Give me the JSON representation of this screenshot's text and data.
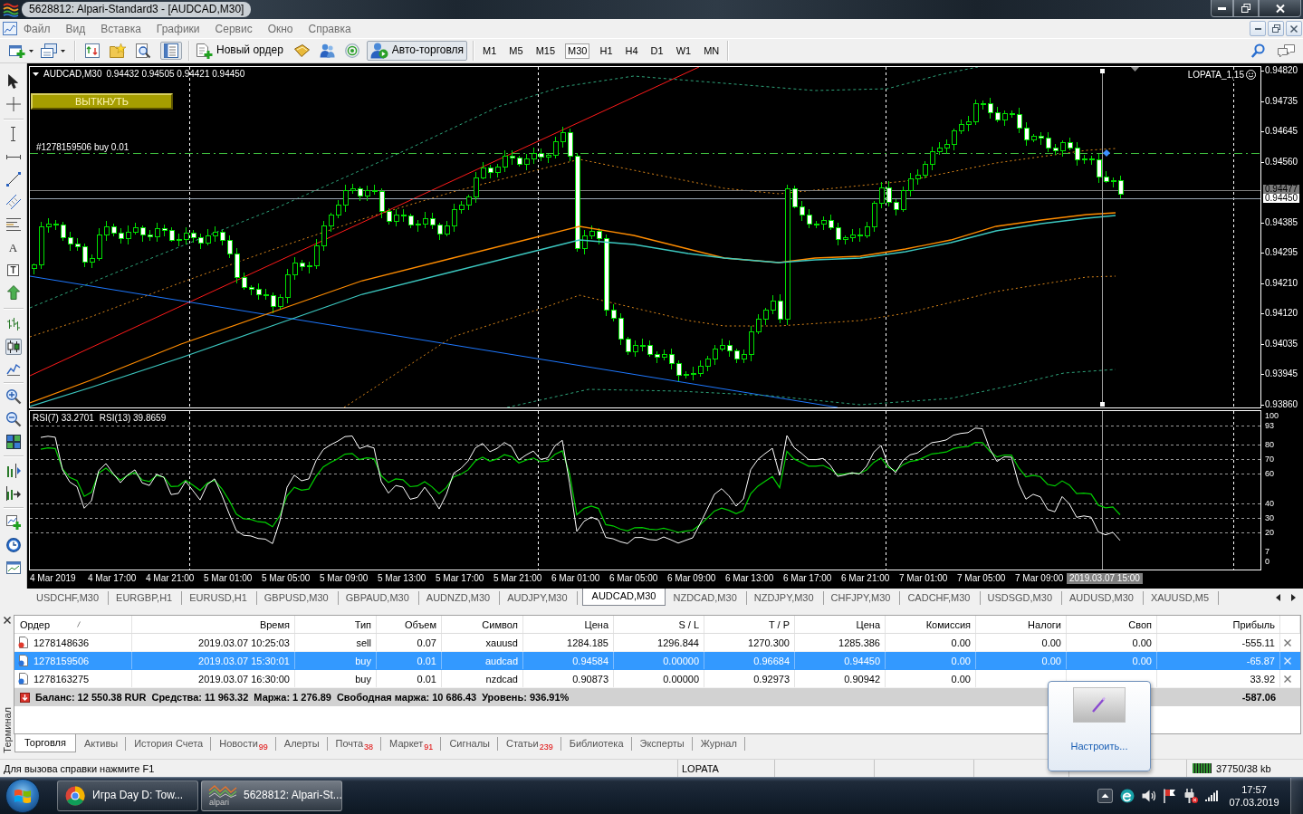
{
  "window": {
    "title": "5628812: Alpari-Standard3 - [AUDCAD,M30]"
  },
  "menu": [
    {
      "label": "Файл"
    },
    {
      "label": "Вид"
    },
    {
      "label": "Вставка"
    },
    {
      "label": "Графики"
    },
    {
      "label": "Сервис"
    },
    {
      "label": "Окно"
    },
    {
      "label": "Справка"
    }
  ],
  "toolbar": {
    "terminal_toggle": {
      "selected": true
    },
    "new_order": "Новый ордер",
    "autotrading": {
      "label": "Авто-торговля",
      "selected": true
    },
    "timeframes": [
      {
        "label": "M1",
        "selected": false
      },
      {
        "label": "M5",
        "selected": false
      },
      {
        "label": "M15",
        "selected": false
      },
      {
        "label": "M30",
        "selected": true
      },
      {
        "label": "H1",
        "selected": false
      },
      {
        "label": "H4",
        "selected": false
      },
      {
        "label": "D1",
        "selected": false
      },
      {
        "label": "W1",
        "selected": false
      },
      {
        "label": "MN",
        "selected": false
      }
    ]
  },
  "left_toolbar": [
    [
      {
        "kind": "cursor"
      },
      {
        "kind": "crosshair"
      }
    ],
    [
      {
        "kind": "vline"
      },
      {
        "kind": "hline"
      },
      {
        "kind": "trendline"
      },
      {
        "kind": "channel"
      },
      {
        "kind": "fibo"
      },
      {
        "kind": "text",
        "label": "A"
      },
      {
        "kind": "text_label",
        "label": "T"
      },
      {
        "kind": "arrows"
      }
    ],
    [
      {
        "kind": "bar_chart",
        "selected": false
      },
      {
        "kind": "candle_chart",
        "selected": true
      },
      {
        "kind": "line_chart",
        "selected": false
      }
    ],
    [
      {
        "kind": "zoom_in"
      },
      {
        "kind": "zoom_out"
      },
      {
        "kind": "tile"
      }
    ],
    [
      {
        "kind": "chart_shift"
      },
      {
        "kind": "autoscroll"
      }
    ],
    [
      {
        "kind": "indicators"
      },
      {
        "kind": "periods"
      },
      {
        "kind": "templates"
      }
    ]
  ],
  "chart": {
    "symbol": "AUDCAD,M30",
    "quote": "0.94432 0.94505 0.94421 0.94450",
    "button": "ВЫТКНУТЬ",
    "order_line": "#1278159506 buy 0.01",
    "expert": "LOPATA_1,15",
    "price_axis": [
      {
        "label": "0.94820",
        "kind": "tick"
      },
      {
        "label": "0.94735",
        "kind": "tick"
      },
      {
        "label": "0.94645",
        "kind": "tick"
      },
      {
        "label": "0.94560",
        "kind": "tick"
      },
      {
        "label": "0.94477",
        "kind": "ask"
      },
      {
        "label": "0.94450",
        "kind": "bid"
      },
      {
        "label": "0.94385",
        "kind": "tick"
      },
      {
        "label": "0.94295",
        "kind": "tick"
      },
      {
        "label": "0.94210",
        "kind": "tick"
      },
      {
        "label": "0.94120",
        "kind": "tick"
      },
      {
        "label": "0.94035",
        "kind": "tick"
      },
      {
        "label": "0.93945",
        "kind": "tick"
      },
      {
        "label": "0.93860",
        "kind": "tick"
      }
    ],
    "rsi_readings": [
      "RSI(7) 33.2701",
      "RSI(13) 39.8659"
    ],
    "rsi_axis": [
      "100",
      "93",
      "80",
      "70",
      "60",
      "40",
      "30",
      "20",
      "7",
      "0"
    ],
    "time_axis": [
      "4 Mar 2019",
      "4 Mar 17:00",
      "4 Mar 21:00",
      "5 Mar 01:00",
      "5 Mar 05:00",
      "5 Mar 09:00",
      "5 Mar 13:00",
      "5 Mar 17:00",
      "5 Mar 21:00",
      "6 Mar 01:00",
      "6 Mar 05:00",
      "6 Mar 09:00",
      "6 Mar 13:00",
      "6 Mar 17:00",
      "6 Mar 21:00",
      "7 Mar 01:00",
      "7 Mar 05:00",
      "7 Mar 09:00"
    ],
    "cursor_time": "2019.03.07 15:00"
  },
  "symbol_tabs": [
    {
      "label": "USDCHF,M30",
      "selected": false
    },
    {
      "label": "EURGBP,H1",
      "selected": false
    },
    {
      "label": "EURUSD,H1",
      "selected": false
    },
    {
      "label": "GBPUSD,M30",
      "selected": false
    },
    {
      "label": "GBPAUD,M30",
      "selected": false
    },
    {
      "label": "AUDNZD,M30",
      "selected": false
    },
    {
      "label": "AUDJPY,M30",
      "selected": false
    },
    {
      "label": "AUDCAD,M30",
      "selected": true
    },
    {
      "label": "NZDCAD,M30",
      "selected": false
    },
    {
      "label": "NZDJPY,M30",
      "selected": false
    },
    {
      "label": "CHFJPY,M30",
      "selected": false
    },
    {
      "label": "CADCHF,M30",
      "selected": false
    },
    {
      "label": "USDSGD,M30",
      "selected": false
    },
    {
      "label": "AUDUSD,M30",
      "selected": false
    },
    {
      "label": "XAUUSD,M5",
      "selected": false
    }
  ],
  "terminal": {
    "title": "Терминал",
    "columns": [
      "Ордер",
      "Время",
      "Тип",
      "Объем",
      "Символ",
      "Цена",
      "S / L",
      "T / P",
      "Цена",
      "Комиссия",
      "Налоги",
      "Своп",
      "Прибыль"
    ],
    "rows": [
      {
        "kind": "sell",
        "selected": false,
        "order": "1278148636",
        "time": "2019.03.07 10:25:03",
        "type": "sell",
        "volume": "0.07",
        "symbol": "xauusd",
        "open_price": "1284.185",
        "sl": "1296.844",
        "tp": "1270.300",
        "price": "1285.386",
        "commission": "0.00",
        "taxes": "0.00",
        "swap": "0.00",
        "profit": "-555.11"
      },
      {
        "kind": "buy",
        "selected": true,
        "order": "1278159506",
        "time": "2019.03.07 15:30:01",
        "type": "buy",
        "volume": "0.01",
        "symbol": "audcad",
        "open_price": "0.94584",
        "sl": "0.00000",
        "tp": "0.96684",
        "price": "0.94450",
        "commission": "0.00",
        "taxes": "0.00",
        "swap": "0.00",
        "profit": "-65.87"
      },
      {
        "kind": "buy",
        "selected": false,
        "order": "1278163275",
        "time": "2019.03.07 16:30:00",
        "type": "buy",
        "volume": "0.01",
        "symbol": "nzdcad",
        "open_price": "0.90873",
        "sl": "0.00000",
        "tp": "0.92973",
        "price": "0.90942",
        "commission": "0.00",
        "profit": "33.92"
      }
    ],
    "summary": {
      "parts": [
        "Баланс: 12 550.38 RUR",
        "Средства: 11 963.32",
        "Маржа: 1 276.89",
        "Свободная маржа: 10 686.43",
        "Уровень: 936.91%"
      ],
      "profit": "-587.06"
    },
    "tabs": [
      {
        "label": "Торговля",
        "selected": true
      },
      {
        "label": "Активы",
        "selected": false
      },
      {
        "label": "История Счета",
        "selected": false
      },
      {
        "label": "Новости",
        "count": "99",
        "selected": false
      },
      {
        "label": "Алерты",
        "selected": false
      },
      {
        "label": "Почта",
        "count": "38",
        "selected": false
      },
      {
        "label": "Маркет",
        "count": "91",
        "selected": false
      },
      {
        "label": "Сигналы",
        "selected": false
      },
      {
        "label": "Статьи",
        "count": "239",
        "selected": false
      },
      {
        "label": "Библиотека",
        "selected": false
      },
      {
        "label": "Эксперты",
        "selected": false
      },
      {
        "label": "Журнал",
        "selected": false
      }
    ]
  },
  "popup": {
    "link": "Настроить..."
  },
  "status_bar": {
    "help": "Для вызова справки нажмите F1",
    "profile": "LOPATA",
    "traffic": "37750/38 kb"
  },
  "taskbar": {
    "tasks": [
      {
        "kind": "browser",
        "label": "Игра Day D: Tow...",
        "selected": false
      },
      {
        "kind": "terminal",
        "label": "5628812: Alpari-St...",
        "icon_caption": "alpari",
        "selected": true
      }
    ],
    "clock": {
      "time": "17:57",
      "date": "07.03.2019"
    }
  }
}
